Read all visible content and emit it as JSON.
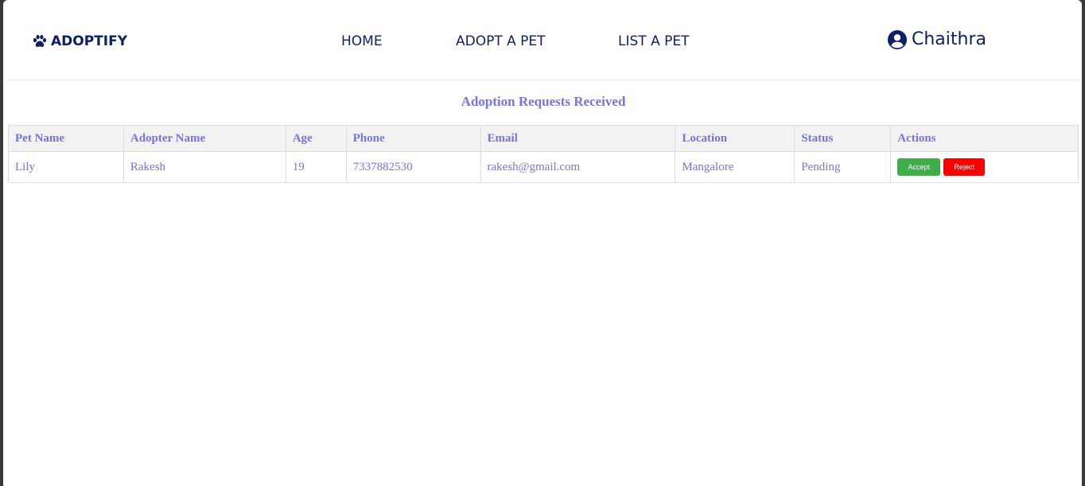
{
  "nav": {
    "brand": "ADOPTIFY",
    "links": [
      "HOME",
      "ADOPT A PET",
      "LIST A PET"
    ],
    "user": "Chaithra"
  },
  "page": {
    "title": "Adoption Requests Received"
  },
  "table": {
    "headers": [
      "Pet Name",
      "Adopter Name",
      "Age",
      "Phone",
      "Email",
      "Location",
      "Status",
      "Actions"
    ],
    "rows": [
      {
        "pet_name": "Lily",
        "adopter_name": "Rakesh",
        "age": "19",
        "phone": "7337882530",
        "email": "rakesh@gmail.com",
        "location": "Mangalore",
        "status": "Pending",
        "accept_label": "Accept",
        "reject_label": "Reject"
      }
    ]
  },
  "colors": {
    "nav_text": "#0d1f66",
    "accent_text": "#7474e2",
    "accept": "#3fad4a",
    "reject": "#ff0000"
  },
  "icons": {
    "brand": "paw-icon",
    "user": "user-circle-icon"
  }
}
